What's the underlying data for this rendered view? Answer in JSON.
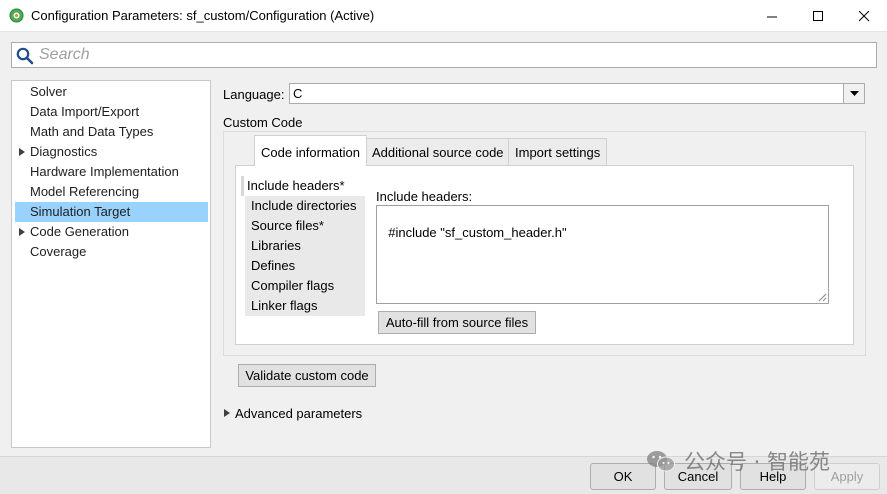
{
  "window": {
    "title": "Configuration Parameters: sf_custom/Configuration (Active)"
  },
  "search": {
    "placeholder": "Search"
  },
  "tree": {
    "items": [
      {
        "label": "Solver",
        "expandable": false,
        "selected": false
      },
      {
        "label": "Data Import/Export",
        "expandable": false,
        "selected": false
      },
      {
        "label": "Math and Data Types",
        "expandable": false,
        "selected": false
      },
      {
        "label": "Diagnostics",
        "expandable": true,
        "selected": false
      },
      {
        "label": "Hardware Implementation",
        "expandable": false,
        "selected": false
      },
      {
        "label": "Model Referencing",
        "expandable": false,
        "selected": false
      },
      {
        "label": "Simulation Target",
        "expandable": false,
        "selected": true
      },
      {
        "label": "Code Generation",
        "expandable": true,
        "selected": false
      },
      {
        "label": "Coverage",
        "expandable": false,
        "selected": false
      }
    ]
  },
  "language": {
    "label": "Language:",
    "value": "C"
  },
  "custom_code": {
    "label": "Custom Code",
    "tabs": [
      {
        "label": "Code information",
        "active": true
      },
      {
        "label": "Additional source code",
        "active": false
      },
      {
        "label": "Import settings",
        "active": false
      }
    ],
    "side_items": [
      {
        "label": "Include headers*",
        "active": true
      },
      {
        "label": "Include directories",
        "active": false
      },
      {
        "label": "Source files*",
        "active": false
      },
      {
        "label": "Libraries",
        "active": false
      },
      {
        "label": "Defines",
        "active": false
      },
      {
        "label": "Compiler flags",
        "active": false
      },
      {
        "label": "Linker flags",
        "active": false
      }
    ],
    "include_headers_label": "Include headers:",
    "include_headers_value": "#include \"sf_custom_header.h\"",
    "autofill_label": "Auto-fill from source files"
  },
  "validate_label": "Validate custom code",
  "advanced_label": "Advanced parameters",
  "footer": {
    "ok": "OK",
    "cancel": "Cancel",
    "help": "Help",
    "apply": "Apply"
  },
  "watermark": {
    "text": "公众号 · 智能苑"
  },
  "colors": {
    "selection": "#99d1ff",
    "window_bg": "#f0f0f0"
  }
}
